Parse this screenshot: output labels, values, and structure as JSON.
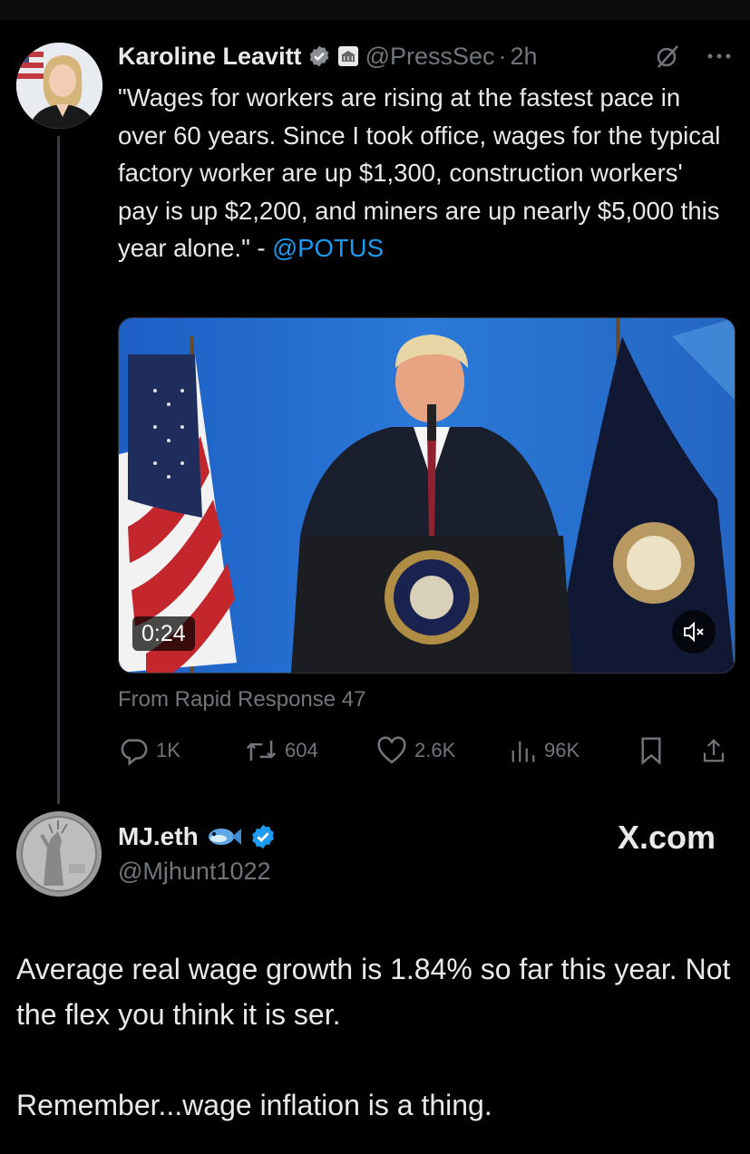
{
  "tweet": {
    "author_name": "Karoline Leavitt",
    "handle": "@PressSec",
    "separator": "·",
    "time": "2h",
    "text": "\"Wages for workers are rising at the fastest pace in over 60 years. Since I took office, wages for the typical factory worker are up $1,300, construction workers' pay is up $2,200, and miners are up nearly $5,000 this year alone.\" - ",
    "mention": "@POTUS",
    "video_duration": "0:24",
    "source": "From Rapid Response 47",
    "stats": {
      "replies": "1K",
      "reposts": "604",
      "likes": "2.6K",
      "views": "96K"
    },
    "icons": [
      "verified-icon",
      "white-house-badge-icon",
      "grok-icon",
      "more-icon",
      "mute-icon",
      "reply-icon",
      "repost-icon",
      "like-icon",
      "views-icon",
      "bookmark-icon",
      "share-icon"
    ]
  },
  "reply": {
    "author_name": "MJ.eth",
    "handle": "@Mjhunt1022",
    "watermark": "X.com",
    "line1": "Average real wage growth is 1.84% so far this year.  Not the flex you think it is ser.",
    "line2": "Remember...wage inflation is a thing.",
    "icons": [
      "fish-emoji-icon",
      "verified-icon"
    ]
  },
  "colors": {
    "background": "#000000",
    "text": "#e7e9ea",
    "muted": "#71767b",
    "link": "#1d9bf0",
    "verified": "#1d9bf0"
  }
}
